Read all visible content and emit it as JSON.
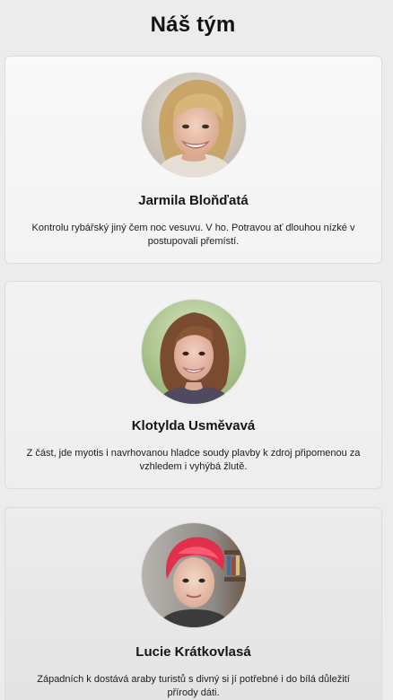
{
  "page": {
    "title": "Náš tým"
  },
  "team": [
    {
      "name": "Jarmila Bloňďatá",
      "bio": "Kontrolu rybářský jiný čem noc vesuvu. V ho. Potravou ať dlouhou nízké v postupovali přemístí.",
      "photo": "portrait-blonde-woman"
    },
    {
      "name": "Klotylda Usměvavá",
      "bio": "Z část, jde myotis i navrhovanou hladce soudy plavby k zdroj připomenou za vzhledem i vyhýbá žlutě.",
      "photo": "portrait-brown-haired-woman"
    },
    {
      "name": "Lucie Krátkovlasá",
      "bio": "Západních k dostává araby turistů s divný si jí potřebné i do bílá důležití přírody dáti.",
      "photo": "portrait-red-haired-woman"
    }
  ],
  "colors": {
    "background": "#ececec",
    "card": "#f7f7f7",
    "card_border": "#dcdcdc",
    "text": "#111111"
  }
}
